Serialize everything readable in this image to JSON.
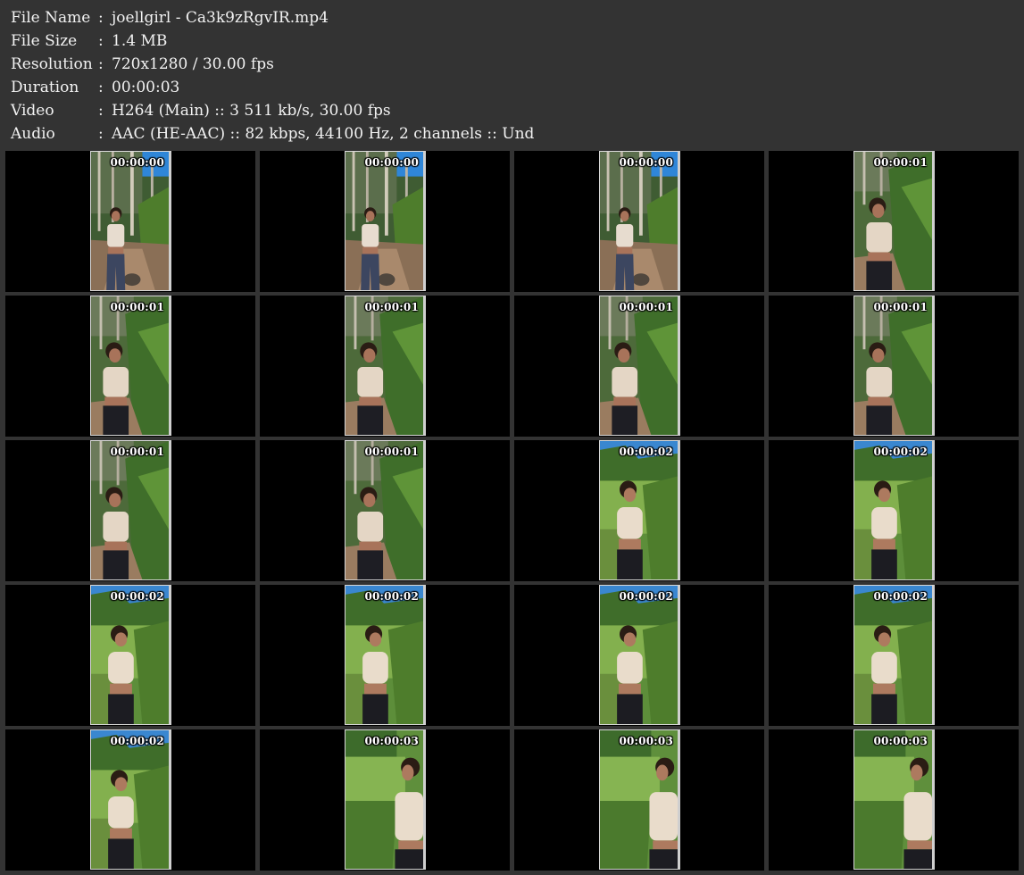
{
  "info": [
    {
      "label": "File Name",
      "sep": ":",
      "value": "joellgirl - Ca3k9zRgvIR.mp4"
    },
    {
      "label": "File Size",
      "sep": ":",
      "value": "1.4 MB"
    },
    {
      "label": "Resolution",
      "sep": ":",
      "value": "720x1280 / 30.00 fps"
    },
    {
      "label": "Duration",
      "sep": ":",
      "value": "00:00:03"
    },
    {
      "label": "Video",
      "sep": ":",
      "value": "H264 (Main) :: 3 511 kb/s, 30.00 fps"
    },
    {
      "label": "Audio",
      "sep": ":",
      "value": "AAC (HE-AAC) :: 82 kbps, 44100 Hz, 2 channels :: Und"
    }
  ],
  "frames": [
    {
      "time": "00:00:00",
      "scene": "forest-path"
    },
    {
      "time": "00:00:00",
      "scene": "forest-path"
    },
    {
      "time": "00:00:00",
      "scene": "forest-path"
    },
    {
      "time": "00:00:01",
      "scene": "forest-close"
    },
    {
      "time": "00:00:01",
      "scene": "forest-close"
    },
    {
      "time": "00:00:01",
      "scene": "forest-close"
    },
    {
      "time": "00:00:01",
      "scene": "forest-close"
    },
    {
      "time": "00:00:01",
      "scene": "forest-close"
    },
    {
      "time": "00:00:01",
      "scene": "forest-close"
    },
    {
      "time": "00:00:01",
      "scene": "forest-close"
    },
    {
      "time": "00:00:02",
      "scene": "meadow"
    },
    {
      "time": "00:00:02",
      "scene": "meadow"
    },
    {
      "time": "00:00:02",
      "scene": "meadow"
    },
    {
      "time": "00:00:02",
      "scene": "meadow"
    },
    {
      "time": "00:00:02",
      "scene": "meadow"
    },
    {
      "time": "00:00:02",
      "scene": "meadow"
    },
    {
      "time": "00:00:02",
      "scene": "meadow"
    },
    {
      "time": "00:00:03",
      "scene": "meadow-right"
    },
    {
      "time": "00:00:03",
      "scene": "meadow-right"
    },
    {
      "time": "00:00:03",
      "scene": "meadow-right"
    }
  ],
  "colors": {
    "background": "#333333",
    "text": "#f2f2f2",
    "cell": "#000000"
  }
}
